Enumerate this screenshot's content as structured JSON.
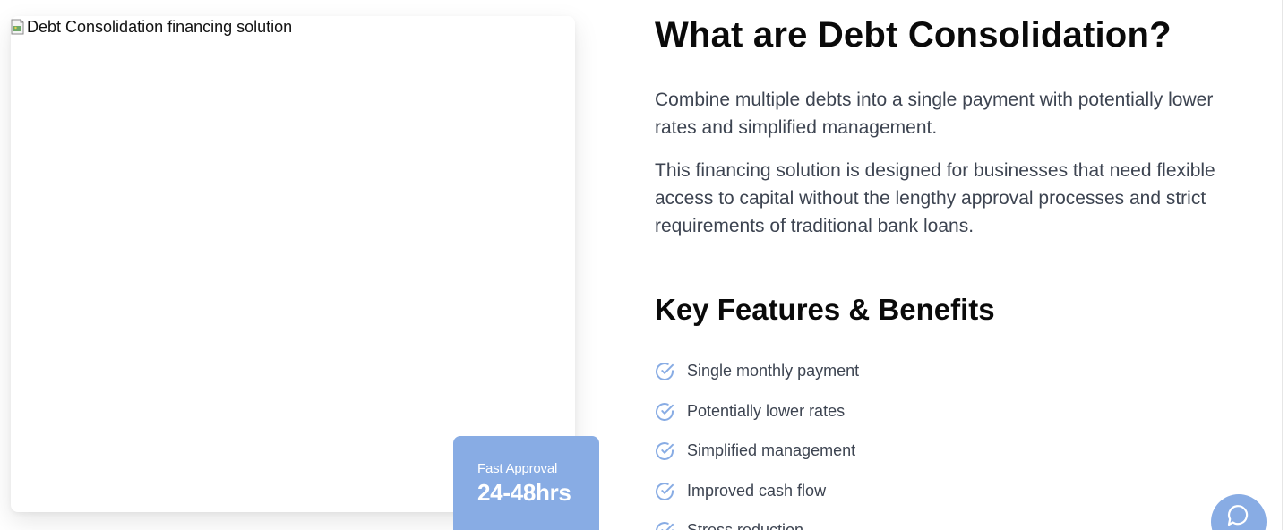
{
  "image": {
    "alt": "Debt Consolidation financing solution",
    "icon": "broken-image-icon"
  },
  "badge": {
    "label": "Fast Approval",
    "value": "24-48hrs",
    "color": "#88ace4"
  },
  "content": {
    "title": "What are Debt Consolidation?",
    "paragraphs": [
      "Combine multiple debts into a single payment with potentially lower rates and simplified management.",
      "This financing solution is designed for businesses that need flexible access to capital without the lengthy approval processes and strict requirements of traditional bank loans."
    ],
    "features_heading": "Key Features & Benefits",
    "features": [
      {
        "label": "Single monthly payment",
        "icon": "check-circle-icon"
      },
      {
        "label": "Potentially lower rates",
        "icon": "check-circle-icon"
      },
      {
        "label": "Simplified management",
        "icon": "check-circle-icon"
      },
      {
        "label": "Improved cash flow",
        "icon": "check-circle-icon"
      },
      {
        "label": "Stress reduction",
        "icon": "check-circle-icon"
      }
    ]
  },
  "chat": {
    "icon": "chat-bubble-icon",
    "color": "#88ace4"
  },
  "colors": {
    "accent": "#88ace4",
    "body_text": "#3d4451",
    "heading": "#0a0a0a"
  }
}
